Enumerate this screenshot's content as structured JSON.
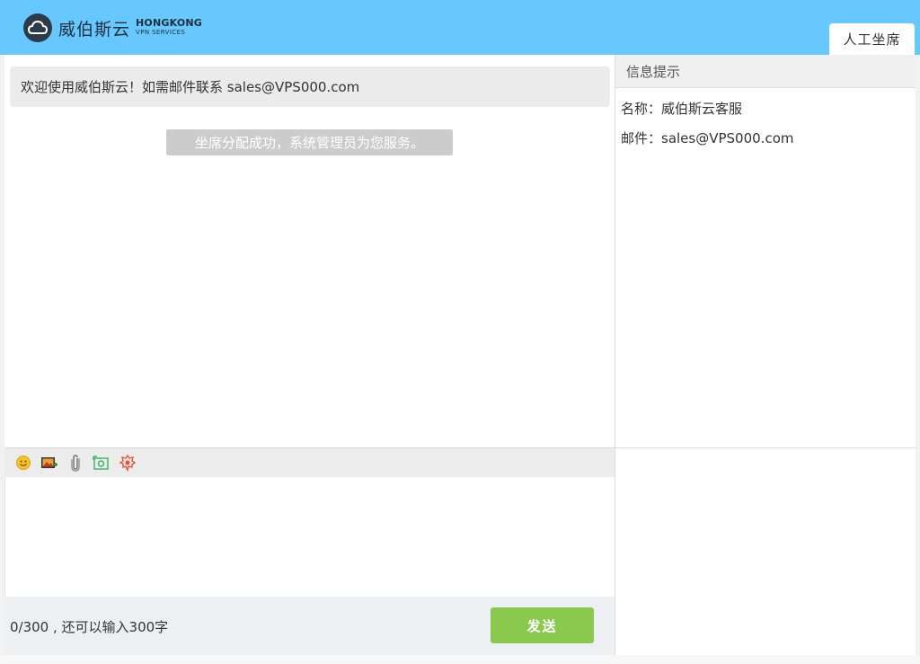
{
  "header": {
    "brand_name": "威伯斯云",
    "brand_sub_line1": "HONGKONG",
    "brand_sub_line2": "VPN SERVICES",
    "agent_tab": "人工坐席",
    "bg_color": "#66c8ff"
  },
  "chat": {
    "welcome": "欢迎使用威伯斯云！如需邮件联系 sales@VPS000.com",
    "system_message": "坐席分配成功，系统管理员为您服务。"
  },
  "toolbar": {
    "icons": [
      "emoji-icon",
      "image-icon",
      "attachment-icon",
      "screenshot-icon",
      "rate-icon"
    ]
  },
  "composer": {
    "value": "",
    "counter": "0/300 , 还可以输入300字",
    "send_label": "发送",
    "send_color": "#8bc94e"
  },
  "info": {
    "title": "信息提示",
    "name_line": "名称：威伯斯云客服",
    "email_line": "邮件：sales@VPS000.com"
  }
}
